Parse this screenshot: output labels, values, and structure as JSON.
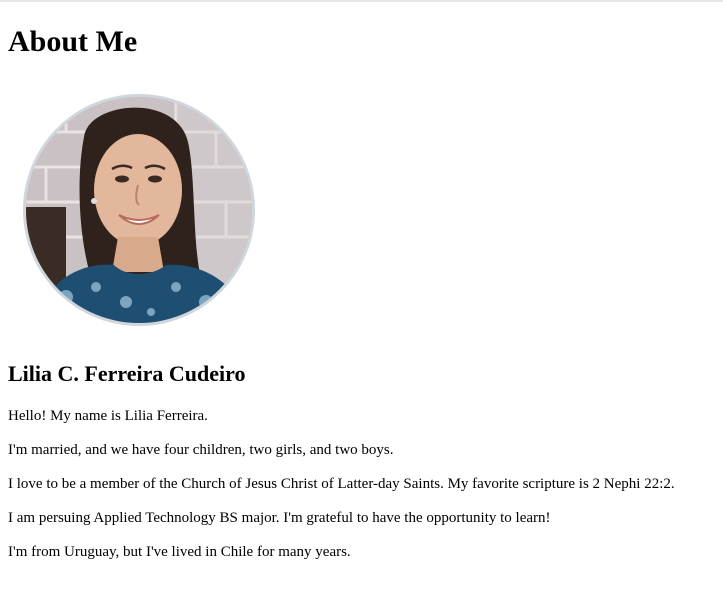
{
  "page": {
    "title": "About Me",
    "name": "Lilia C. Ferreira Cudeiro",
    "profile_photo": "profile-photo",
    "paragraphs": [
      "Hello! My name is Lilia Ferreira.",
      "I'm married, and we have four children, two girls, and two boys.",
      "I love to be a member of the Church of Jesus Christ of Latter-day Saints. My favorite scripture is 2 Nephi 22:2.",
      "I am persuing Applied Technology BS major. I'm grateful to have the opportunity to learn!",
      "I'm from Uruguay, but I've lived in Chile for many years."
    ]
  }
}
